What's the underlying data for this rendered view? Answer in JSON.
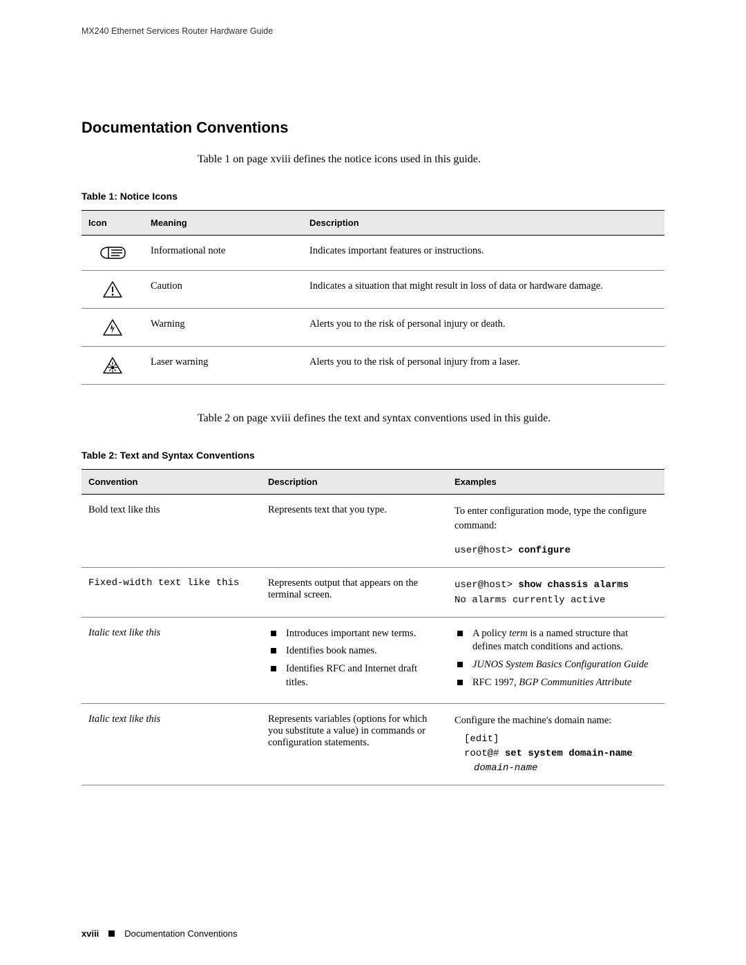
{
  "header": {
    "running_head": "MX240 Ethernet Services Router Hardware Guide"
  },
  "section_title": "Documentation Conventions",
  "intro1": "Table 1 on page xviii defines the notice icons used in this guide.",
  "table1": {
    "title": "Table 1: Notice Icons",
    "headers": {
      "icon": "Icon",
      "meaning": "Meaning",
      "description": "Description"
    },
    "rows": [
      {
        "meaning": "Informational note",
        "description": "Indicates important features or instructions."
      },
      {
        "meaning": "Caution",
        "description": "Indicates a situation that might result in loss of data or hardware damage."
      },
      {
        "meaning": "Warning",
        "description": "Alerts you to the risk of personal injury or death."
      },
      {
        "meaning": "Laser warning",
        "description": "Alerts you to the risk of personal injury from a laser."
      }
    ]
  },
  "intro2": "Table 2 on page xviii defines the text and syntax conventions used in this guide.",
  "table2": {
    "title": "Table 2: Text and Syntax Conventions",
    "headers": {
      "convention": "Convention",
      "description": "Description",
      "examples": "Examples"
    },
    "rows": [
      {
        "convention": "Bold text like this",
        "description": "Represents text that you type.",
        "example_intro": "To enter configuration mode, type the ",
        "example_intro2": " command:",
        "example_cmd_word": "configure",
        "example_prompt": "user@host> ",
        "example_bold": "configure"
      },
      {
        "convention": "Fixed-width text like this",
        "description": "Represents output that appears on the terminal screen.",
        "example_line1_prompt": "user@host> ",
        "example_line1_bold": "show chassis alarms",
        "example_line2": "No alarms currently active"
      },
      {
        "convention": "Italic text like this",
        "desc_items": [
          "Introduces important new terms.",
          "Identifies book names.",
          "Identifies RFC and Internet draft titles."
        ],
        "ex_items": {
          "i1_pre": "A policy ",
          "i1_term": "term",
          "i1_post": " is a named structure that defines match conditions and actions.",
          "i2": "JUNOS System Basics Configuration Guide",
          "i3_pre": "RFC 1997, ",
          "i3_ital": "BGP Communities Attribute"
        }
      },
      {
        "convention": "Italic text like this",
        "description": "Represents variables (options for which you substitute a value) in commands or configuration statements.",
        "ex_intro": "Configure the machine's domain name:",
        "ex_l1": "[edit]",
        "ex_l2_prompt": "root@# ",
        "ex_l2_bold": "set system domain-name",
        "ex_l3_ital": "domain-name"
      }
    ]
  },
  "footer": {
    "pagenum": "xviii",
    "title": "Documentation Conventions"
  }
}
